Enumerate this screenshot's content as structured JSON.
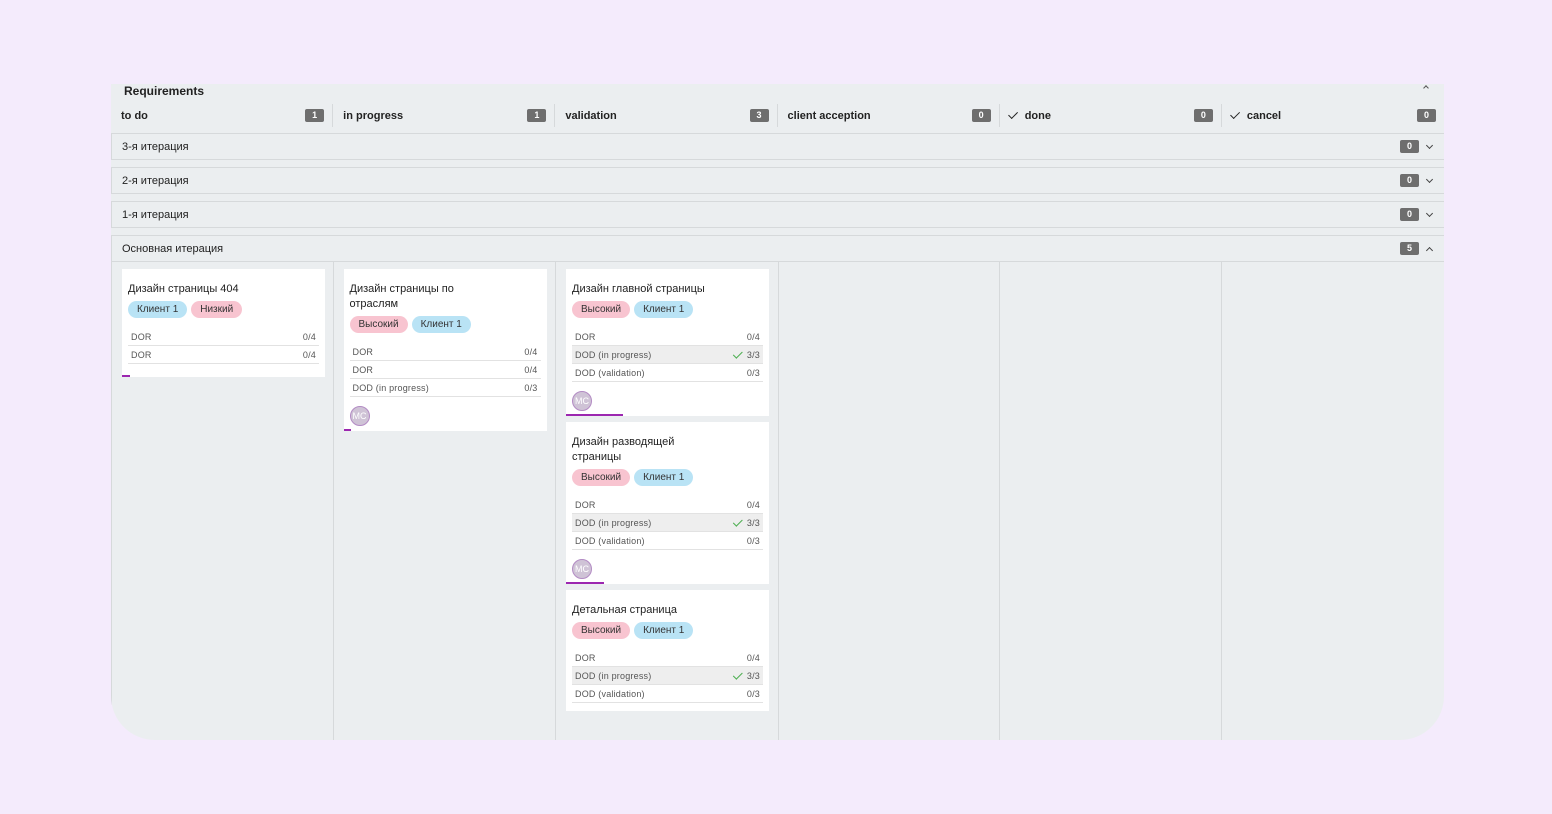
{
  "board": {
    "title": "Requirements",
    "columns": [
      {
        "label": "to do",
        "count": "1",
        "check": false
      },
      {
        "label": "in progress",
        "count": "1",
        "check": false
      },
      {
        "label": "validation",
        "count": "3",
        "check": false
      },
      {
        "label": "client acception",
        "count": "0",
        "check": false
      },
      {
        "label": "done",
        "count": "0",
        "check": true
      },
      {
        "label": "cancel",
        "count": "0",
        "check": true
      }
    ],
    "groups": [
      {
        "label": "3-я итерация",
        "count": "0",
        "expanded": false
      },
      {
        "label": "2-я итерация",
        "count": "0",
        "expanded": false
      },
      {
        "label": "1-я итерация",
        "count": "0",
        "expanded": false
      },
      {
        "label": "Основная итерация",
        "count": "5",
        "expanded": true
      }
    ]
  },
  "cards": {
    "todo_1": {
      "title": "Дизайн страницы 404",
      "tags": [
        {
          "label": "Клиент 1",
          "color": "#b9e3f5"
        },
        {
          "label": "Низкий",
          "color": "#f8c4d0"
        }
      ],
      "checklist": [
        {
          "label": "DOR",
          "value": "0/4",
          "done": false
        },
        {
          "label": "DOR",
          "value": "0/4",
          "done": false
        }
      ],
      "progress": 0.04
    },
    "inprogress_1": {
      "title": "Дизайн страницы по отраслям",
      "tags": [
        {
          "label": "Высокий",
          "color": "#f8c4d0"
        },
        {
          "label": "Клиент 1",
          "color": "#b9e3f5"
        }
      ],
      "checklist": [
        {
          "label": "DOR",
          "value": "0/4",
          "done": false
        },
        {
          "label": "DOR",
          "value": "0/4",
          "done": false
        },
        {
          "label": "DOD (in progress)",
          "value": "0/3",
          "done": false
        }
      ],
      "avatar": "МС",
      "progress": 0.04
    },
    "validation_1": {
      "title": "Дизайн главной страницы",
      "tags": [
        {
          "label": "Высокий",
          "color": "#f8c4d0"
        },
        {
          "label": "Клиент 1",
          "color": "#b9e3f5"
        }
      ],
      "checklist": [
        {
          "label": "DOR",
          "value": "0/4",
          "done": false
        },
        {
          "label": "DOD (in progress)",
          "value": "3/3",
          "done": true
        },
        {
          "label": "DOD (validation)",
          "value": "0/3",
          "done": false
        }
      ],
      "avatar": "МС",
      "progress": 0.3
    },
    "validation_2": {
      "title": "Дизайн разводящей страницы",
      "tags": [
        {
          "label": "Высокий",
          "color": "#f8c4d0"
        },
        {
          "label": "Клиент 1",
          "color": "#b9e3f5"
        }
      ],
      "checklist": [
        {
          "label": "DOR",
          "value": "0/4",
          "done": false
        },
        {
          "label": "DOD (in progress)",
          "value": "3/3",
          "done": true
        },
        {
          "label": "DOD (validation)",
          "value": "0/3",
          "done": false
        }
      ],
      "avatar": "МС",
      "progress": 0.2
    },
    "validation_3": {
      "title": "Детальная страница",
      "tags": [
        {
          "label": "Высокий",
          "color": "#f8c4d0"
        },
        {
          "label": "Клиент 1",
          "color": "#b9e3f5"
        }
      ],
      "checklist": [
        {
          "label": "DOR",
          "value": "0/4",
          "done": false
        },
        {
          "label": "DOD (in progress)",
          "value": "3/3",
          "done": true
        },
        {
          "label": "DOD (validation)",
          "value": "0/3",
          "done": false
        }
      ]
    }
  },
  "colors": {
    "accent": "#9c27b0",
    "badge": "#6e6e6e",
    "check": "#4caf50"
  }
}
